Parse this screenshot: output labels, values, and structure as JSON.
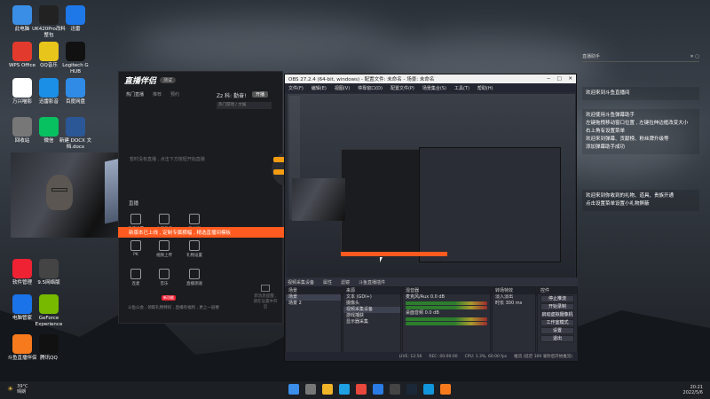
{
  "desktop_icons": [
    {
      "label": "此电脑",
      "icon": "computer-icon",
      "color": "#3a8ee6"
    },
    {
      "label": "UK420Pro改料整包",
      "icon": "folder-icon",
      "color": "#222"
    },
    {
      "label": "迅雷",
      "icon": "bird-icon",
      "color": "#1e78e8"
    },
    {
      "label": "WPS Office",
      "icon": "wps-icon",
      "color": "#e23b2d"
    },
    {
      "label": "QQ音乐",
      "icon": "music-icon",
      "color": "#e8c51a"
    },
    {
      "label": "Logitech G HUB",
      "icon": "logitech-icon",
      "color": "#111"
    },
    {
      "label": "万兴喵影",
      "icon": "video-edit-icon",
      "color": "#fff"
    },
    {
      "label": "迅雷影音",
      "icon": "player-icon",
      "color": "#1b8fe5"
    },
    {
      "label": "百度网盘",
      "icon": "cloud-drive-icon",
      "color": "#2f8be6"
    },
    {
      "label": "回收站",
      "icon": "recycle-bin-icon",
      "color": "#777"
    },
    {
      "label": "微信",
      "icon": "wechat-icon",
      "color": "#07c160"
    },
    {
      "label": "新建 DOCX 文档.docx",
      "icon": "word-icon",
      "color": "#2b5797"
    },
    {
      "label": "软件管理",
      "icon": "app-store-icon",
      "color": "#e23"
    },
    {
      "label": "9.5网络版",
      "icon": "network-icon",
      "color": "#444"
    },
    {
      "label": "电脑管家",
      "icon": "pc-manager-icon",
      "color": "#1a73e8"
    },
    {
      "label": "GeForce Experience",
      "icon": "nvidia-icon",
      "color": "#76b900"
    },
    {
      "label": "斗鱼直播伴侣",
      "icon": "douyu-icon",
      "color": "#f77a1c"
    },
    {
      "label": "腾讯QQ",
      "icon": "qq-icon",
      "color": "#111"
    }
  ],
  "live_app": {
    "logo": "直播伴侣",
    "beta": "测试",
    "tabs": [
      "热门直播",
      "推荐",
      "预约"
    ],
    "empty_text": "暂时没有直播 , 点击下方按钮开始直播",
    "room_label": "Zz 科: 勤奋!",
    "room_button": "开播",
    "search_placeholder": "热门游戏 / 文娱",
    "hint_title": "直播",
    "banner": "新版本已上线 , 定制专属横幅 , 精选直播间模板",
    "tools": [
      {
        "label": "直播设置",
        "icon": "settings-icon"
      },
      {
        "label": "主播任务",
        "icon": "user-icon"
      },
      {
        "label": "粉丝团",
        "icon": "gift-icon"
      },
      {
        "label": "PK",
        "icon": "pk-icon"
      },
      {
        "label": "视频上传",
        "icon": "upload-icon"
      },
      {
        "label": "礼物设置",
        "icon": "gift-settings-icon"
      },
      {
        "label": "连麦",
        "icon": "mic-icon"
      },
      {
        "label": "音乐",
        "icon": "music-note-icon"
      },
      {
        "label": "直播测速",
        "icon": "speed-icon"
      }
    ],
    "badges": [
      "新功能",
      "新功能"
    ],
    "footer": "斗鱼公会 , 领取礼物特权 , 直播有福利 , 更上一层楼",
    "chat_hint": "新消息提醒 , 请在设置中开启"
  },
  "obs": {
    "title": "OBS 27.2.4 (64-bit, windows) - 配置文件: 未命名 - 场景: 未命名",
    "menu": [
      "文件(F)",
      "编辑(E)",
      "视图(V)",
      "停靠窗口(D)",
      "配置文件(P)",
      "场景集合(S)",
      "工具(T)",
      "帮助(H)"
    ],
    "source_bar": [
      "视频采集设备",
      "属性",
      "滤镜",
      "斗鱼直播插件"
    ],
    "docks": {
      "scenes": {
        "title": "场景",
        "items": [
          "场景",
          "场景 2"
        ]
      },
      "sources": {
        "title": "来源",
        "items": [
          "文本 (GDI+)",
          "摄像头",
          "视频采集设备",
          "游戏捕获",
          "显示器采集"
        ]
      },
      "mixer": {
        "title": "混音器",
        "tracks": [
          {
            "name": "麦克风/Aux",
            "db": "0.0 dB"
          },
          {
            "name": "桌面音频",
            "db": "0.0 dB"
          }
        ]
      },
      "transitions": {
        "title": "转场特效",
        "type": "淡入淡出",
        "duration_label": "时长",
        "duration": "300 ms"
      },
      "controls": {
        "title": "控件",
        "buttons": [
          "停止推流",
          "开始录制",
          "启动虚拟摄像机",
          "工作室模式",
          "设置",
          "退出"
        ]
      }
    },
    "status": [
      "LIVE: 12:56",
      "REC: 00:00:00",
      "CPU: 1.3%, 60.00 fps",
      "推流 (延迟 300 毫秒后开始推流)"
    ]
  },
  "notes": {
    "header_left": "直播助手",
    "items": [
      "欢迎来到斗鱼直播间",
      "欢迎使用斗鱼弹幕助手\n左键拖拽移动窗口位置 , 左键拉伸边框改变大小\n右上角有设置菜单\n欢迎来到弹幕、贡献榜、粉丝牌升级等\n添加弹幕助手成功",
      "欢迎来到你收到的礼物、道具、贵族开通\n点击设置菜单设置小礼物屏蔽"
    ]
  },
  "taskbar": {
    "temp": "39°C",
    "weather": "晴朗",
    "time": "20:21",
    "date": "2022/5/6",
    "apps": [
      "start-icon",
      "search-icon",
      "file-explorer-icon",
      "edge-icon",
      "chrome-icon",
      "store-icon",
      "obs-icon",
      "steam-icon",
      "qq-icon",
      "douyu-icon"
    ]
  }
}
